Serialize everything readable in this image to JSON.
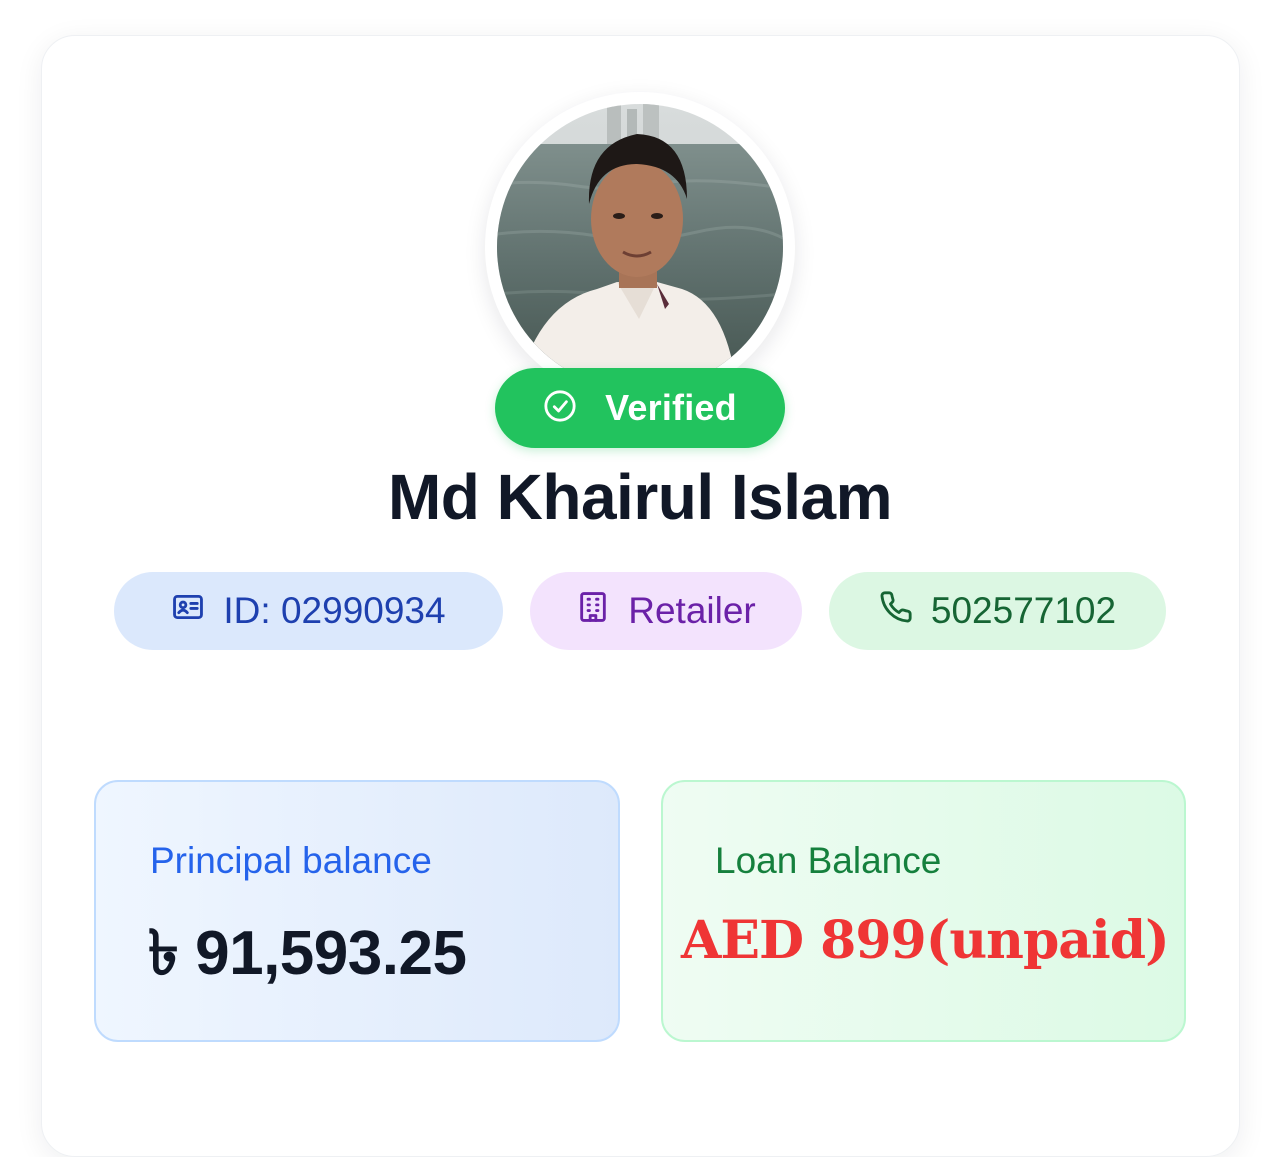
{
  "profile": {
    "name": "Md Khairul Islam",
    "verified_label": "Verified",
    "id_chip": "ID: 02990934",
    "role_chip": "Retailer",
    "phone_chip": "502577102"
  },
  "balances": {
    "principal_label": "Principal balance",
    "principal_value": "৳ 91,593.25",
    "loan_label": "Loan Balance",
    "loan_value": "AED 899(unpaid)"
  },
  "colors": {
    "verified_green": "#22c35e",
    "id_chip_bg": "#dbe8fc",
    "role_chip_bg": "#f3e3fd",
    "phone_chip_bg": "#dcf7e3",
    "loan_value_red": "#ef3535"
  },
  "icons": {
    "verified": "check-circle-icon",
    "id": "id-card-icon",
    "role": "building-icon",
    "phone": "phone-icon"
  }
}
